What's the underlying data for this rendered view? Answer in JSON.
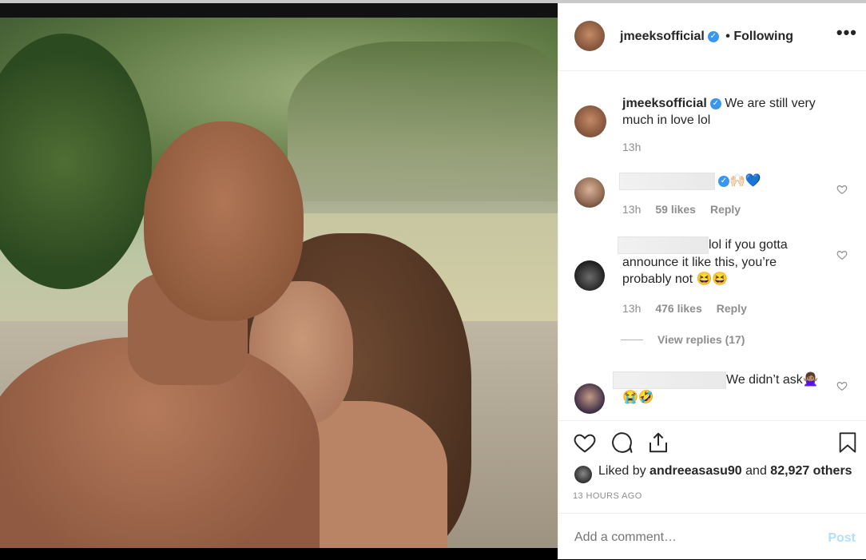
{
  "post": {
    "author": "jmeeksofficial",
    "follow_status": "Following",
    "separator": "•",
    "more_label": "•••"
  },
  "caption": {
    "author": "jmeeksofficial",
    "text_line1": "We are still very",
    "text_line2": "much in love lol",
    "time": "13h"
  },
  "comments": [
    {
      "text_suffix": "🙌🏻💙",
      "time": "13h",
      "likes": "59 likes",
      "reply": "Reply"
    },
    {
      "text_line1": "lol if you gotta",
      "text_line2": "announce it like this, you’re",
      "text_line3": "probably not 😆😆",
      "time": "13h",
      "likes": "476 likes",
      "reply": "Reply",
      "view_replies": "View replies (17)"
    },
    {
      "text_line1": "We didn’t ask🙅🏽‍♀️",
      "text_line2": "😭🤣"
    }
  ],
  "likes": {
    "prefix": "Liked by",
    "user": "andreeasasu90",
    "and": "and",
    "count": "82,927 others"
  },
  "timestamp": "13 HOURS AGO",
  "add_comment": {
    "placeholder": "Add a comment…",
    "post_label": "Post"
  },
  "colors": {
    "accent": "#3897f0",
    "post_disabled": "#b2dffc",
    "muted": "#8e8e8e",
    "text": "#262626"
  }
}
